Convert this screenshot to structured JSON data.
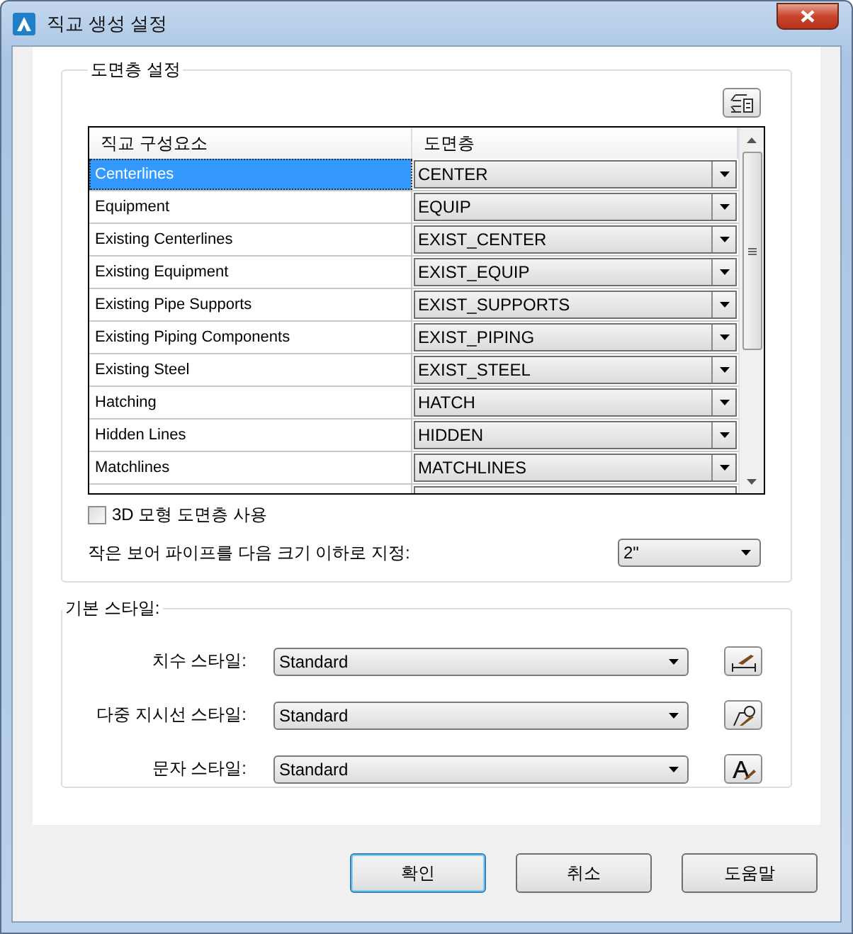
{
  "window": {
    "title": "직교 생성 설정"
  },
  "layer_settings": {
    "title": "도면층 설정",
    "table": {
      "columns": [
        "직교 구성요소",
        "도면층"
      ],
      "rows": [
        {
          "component": "Centerlines",
          "layer": "CENTER",
          "selected": true
        },
        {
          "component": "Equipment",
          "layer": "EQUIP",
          "selected": false
        },
        {
          "component": "Existing Centerlines",
          "layer": "EXIST_CENTER",
          "selected": false
        },
        {
          "component": "Existing Equipment",
          "layer": "EXIST_EQUIP",
          "selected": false
        },
        {
          "component": "Existing Pipe Supports",
          "layer": "EXIST_SUPPORTS",
          "selected": false
        },
        {
          "component": "Existing Piping Components",
          "layer": "EXIST_PIPING",
          "selected": false
        },
        {
          "component": "Existing Steel",
          "layer": "EXIST_STEEL",
          "selected": false
        },
        {
          "component": "Hatching",
          "layer": "HATCH",
          "selected": false
        },
        {
          "component": "Hidden Lines",
          "layer": "HIDDEN",
          "selected": false
        },
        {
          "component": "Matchlines",
          "layer": "MATCHLINES",
          "selected": false
        }
      ]
    },
    "use_3d_layers": {
      "label": "3D 모형 도면층 사용",
      "checked": false
    },
    "small_bore": {
      "label": "작은 보어 파이프를 다음 크기 이하로 지정:",
      "value": "2\""
    }
  },
  "default_styles": {
    "title": "기본 스타일:",
    "rows": [
      {
        "label": "치수 스타일:",
        "value": "Standard",
        "kind": "dimension"
      },
      {
        "label": "다중 지시선 스타일:",
        "value": "Standard",
        "kind": "multileader"
      },
      {
        "label": "문자 스타일:",
        "value": "Standard",
        "kind": "text"
      }
    ]
  },
  "buttons": [
    {
      "label": "확인",
      "default": true
    },
    {
      "label": "취소",
      "default": false
    },
    {
      "label": "도움말",
      "default": false
    }
  ]
}
